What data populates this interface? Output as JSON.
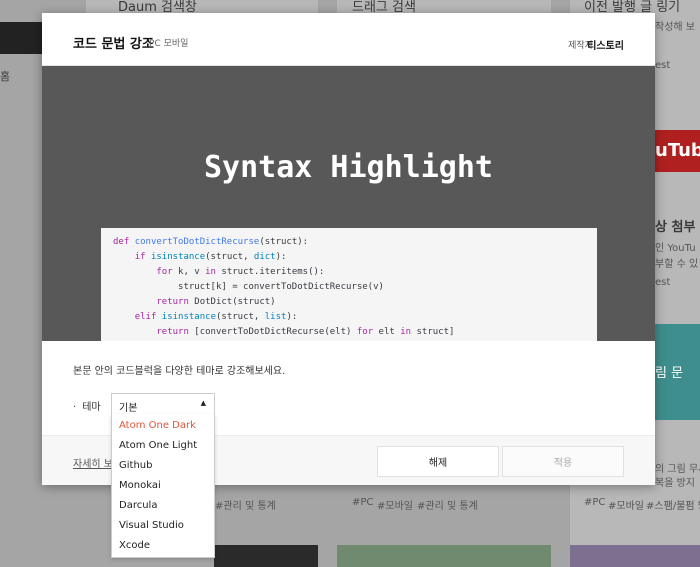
{
  "background": {
    "cards": [
      {
        "title": "Daum 검색창"
      },
      {
        "title": "드래그 검색"
      },
      {
        "title": "이전 발행 글 링기"
      }
    ],
    "right_texts": [
      "작성해 보",
      "상 첨부",
      "인 YouTu",
      "부할 수 있",
      "est",
      "est",
      "림 문"
    ],
    "left_side_text": "홈",
    "tags": [
      "#PC",
      "#모바일",
      "#관리 및 통계",
      "#PC",
      "#모바일",
      "#스팸/불펌 방지"
    ],
    "youtube_text": "uTub",
    "right_card_lines": [
      "의 그림 무사",
      "복을 방지"
    ]
  },
  "modal": {
    "title": "코드 문법 강조",
    "platform": "PC 모바일",
    "maker_label": "제작자",
    "maker_name": "티스토리",
    "preview_title": "Syntax Highlight",
    "code_lines": [
      "def convertToDotDictRecurse(struct):",
      "    if isinstance(struct, dict):",
      "        for k, v in struct.iteritems():",
      "            struct[k] = convertToDotDictRecurse(v)",
      "        return DotDict(struct)",
      "    elif isinstance(struct, list):",
      "        return [convertToDotDictRecurse(elt) for elt in struct]"
    ],
    "description": "본문 안의 코드블럭을 다양한 테마로 강조해보세요.",
    "theme_label": "테마",
    "more_link": "자세히 보",
    "cancel_label": "해제",
    "apply_label": "적용"
  },
  "dropdown": {
    "selected": "기본",
    "options": [
      "Atom One Dark",
      "Atom One Light",
      "Github",
      "Monokai",
      "Darcula",
      "Visual Studio",
      "Xcode"
    ],
    "highlighted": "Atom One Dark"
  },
  "colors": {
    "highlight_option": "#e0563b",
    "preview_bg": "#585858"
  }
}
